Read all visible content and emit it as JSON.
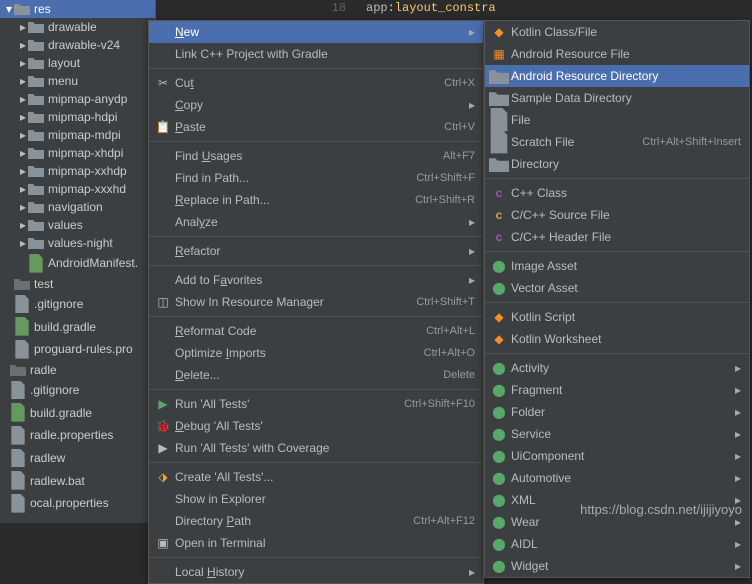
{
  "editor": {
    "line_number": "18",
    "code_prefix": "app",
    "code_attr": ":layout_constra"
  },
  "tree": [
    {
      "label": "res",
      "depth": 0,
      "arrow": "▾",
      "type": "folder",
      "selected": true
    },
    {
      "label": "drawable",
      "depth": 1,
      "arrow": "▸",
      "type": "folder"
    },
    {
      "label": "drawable-v24",
      "depth": 1,
      "arrow": "▸",
      "type": "folder"
    },
    {
      "label": "layout",
      "depth": 1,
      "arrow": "▸",
      "type": "folder"
    },
    {
      "label": "menu",
      "depth": 1,
      "arrow": "▸",
      "type": "folder"
    },
    {
      "label": "mipmap-anydp",
      "depth": 1,
      "arrow": "▸",
      "type": "folder"
    },
    {
      "label": "mipmap-hdpi",
      "depth": 1,
      "arrow": "▸",
      "type": "folder"
    },
    {
      "label": "mipmap-mdpi",
      "depth": 1,
      "arrow": "▸",
      "type": "folder"
    },
    {
      "label": "mipmap-xhdpi",
      "depth": 1,
      "arrow": "▸",
      "type": "folder"
    },
    {
      "label": "mipmap-xxhdp",
      "depth": 1,
      "arrow": "▸",
      "type": "folder"
    },
    {
      "label": "mipmap-xxxhd",
      "depth": 1,
      "arrow": "▸",
      "type": "folder"
    },
    {
      "label": "navigation",
      "depth": 1,
      "arrow": "▸",
      "type": "folder"
    },
    {
      "label": "values",
      "depth": 1,
      "arrow": "▸",
      "type": "folder"
    },
    {
      "label": "values-night",
      "depth": 1,
      "arrow": "▸",
      "type": "folder"
    },
    {
      "label": "AndroidManifest.",
      "depth": 1,
      "arrow": "",
      "type": "manifest"
    },
    {
      "label": "test",
      "depth": 0,
      "arrow": "",
      "type": "folder-dim"
    },
    {
      "label": ".gitignore",
      "depth": 0,
      "arrow": "",
      "type": "file",
      "root": true
    },
    {
      "label": "build.gradle",
      "depth": 0,
      "arrow": "",
      "type": "gradle",
      "root": true
    },
    {
      "label": "proguard-rules.pro",
      "depth": 0,
      "arrow": "",
      "type": "file",
      "root": true
    },
    {
      "label": "radle",
      "depth": 0,
      "arrow": "",
      "type": "folder-dim",
      "cut": true
    },
    {
      "label": ".gitignore",
      "depth": 0,
      "arrow": "",
      "type": "file",
      "cut": true
    },
    {
      "label": "build.gradle",
      "depth": 0,
      "arrow": "",
      "type": "gradle",
      "cut": true
    },
    {
      "label": "radle.properties",
      "depth": 0,
      "arrow": "",
      "type": "file",
      "cut": true
    },
    {
      "label": "radlew",
      "depth": 0,
      "arrow": "",
      "type": "file",
      "cut": true
    },
    {
      "label": "radlew.bat",
      "depth": 0,
      "arrow": "",
      "type": "file",
      "cut": true
    },
    {
      "label": "ocal.properties",
      "depth": 0,
      "arrow": "",
      "type": "file",
      "cut": true
    }
  ],
  "context_menu": [
    {
      "label": "New",
      "highlight": true,
      "submenu": true,
      "u": 0
    },
    {
      "label": "Link C++ Project with Gradle",
      "icon": ""
    },
    {
      "sep": true
    },
    {
      "label": "Cut",
      "shortcut": "Ctrl+X",
      "icon": "cut",
      "u": 2
    },
    {
      "label": "Copy",
      "submenu": true,
      "u": 0
    },
    {
      "label": "Paste",
      "shortcut": "Ctrl+V",
      "icon": "paste",
      "u": 0
    },
    {
      "sep": true
    },
    {
      "label": "Find Usages",
      "shortcut": "Alt+F7",
      "u": 5
    },
    {
      "label": "Find in Path...",
      "shortcut": "Ctrl+Shift+F"
    },
    {
      "label": "Replace in Path...",
      "shortcut": "Ctrl+Shift+R",
      "u": 0
    },
    {
      "label": "Analyze",
      "submenu": true,
      "u": 4
    },
    {
      "sep": true
    },
    {
      "label": "Refactor",
      "submenu": true,
      "u": 0
    },
    {
      "sep": true
    },
    {
      "label": "Add to Favorites",
      "submenu": true,
      "u": 8
    },
    {
      "label": "Show In Resource Manager",
      "shortcut": "Ctrl+Shift+T",
      "icon": "res"
    },
    {
      "sep": true
    },
    {
      "label": "Reformat Code",
      "shortcut": "Ctrl+Alt+L",
      "u": 0
    },
    {
      "label": "Optimize Imports",
      "shortcut": "Ctrl+Alt+O",
      "u": 9
    },
    {
      "label": "Delete...",
      "shortcut": "Delete",
      "u": 0
    },
    {
      "sep": true
    },
    {
      "label": "Run 'All Tests'",
      "shortcut": "Ctrl+Shift+F10",
      "icon": "run"
    },
    {
      "label": "Debug 'All Tests'",
      "icon": "debug",
      "u": 0
    },
    {
      "label": "Run 'All Tests' with Coverage",
      "icon": "coverage"
    },
    {
      "sep": true
    },
    {
      "label": "Create 'All Tests'...",
      "icon": "create"
    },
    {
      "label": "Show in Explorer"
    },
    {
      "label": "Directory Path",
      "shortcut": "Ctrl+Alt+F12",
      "u": 10
    },
    {
      "label": "Open in Terminal",
      "icon": "terminal"
    },
    {
      "sep": true
    },
    {
      "label": "Local History",
      "submenu": true,
      "u": 6
    }
  ],
  "submenu": [
    {
      "label": "Kotlin Class/File",
      "icon": "kotlin",
      "color": "#f88d2b"
    },
    {
      "label": "Android Resource File",
      "icon": "xml",
      "color": "#f88d2b"
    },
    {
      "label": "Android Resource Directory",
      "icon": "folder",
      "highlight": true
    },
    {
      "label": "Sample Data Directory",
      "icon": "folder"
    },
    {
      "label": "File",
      "icon": "file"
    },
    {
      "label": "Scratch File",
      "shortcut": "Ctrl+Alt+Shift+Insert",
      "icon": "file"
    },
    {
      "label": "Directory",
      "icon": "folder"
    },
    {
      "sep": true
    },
    {
      "label": "C++ Class",
      "icon": "cpp",
      "color": "#a050c0"
    },
    {
      "label": "C/C++ Source File",
      "icon": "cpp-src",
      "color": "#c9a94f"
    },
    {
      "label": "C/C++ Header File",
      "icon": "cpp-hdr",
      "color": "#a050c0"
    },
    {
      "sep": true
    },
    {
      "label": "Image Asset",
      "icon": "android"
    },
    {
      "label": "Vector Asset",
      "icon": "android"
    },
    {
      "sep": true
    },
    {
      "label": "Kotlin Script",
      "icon": "kotlin",
      "color": "#f88d2b"
    },
    {
      "label": "Kotlin Worksheet",
      "icon": "kotlin",
      "color": "#f88d2b"
    },
    {
      "sep": true
    },
    {
      "label": "Activity",
      "icon": "android-g",
      "submenu": true
    },
    {
      "label": "Fragment",
      "icon": "android-g",
      "submenu": true
    },
    {
      "label": "Folder",
      "icon": "android-g",
      "submenu": true
    },
    {
      "label": "Service",
      "icon": "android-g",
      "submenu": true
    },
    {
      "label": "UiComponent",
      "icon": "android-g",
      "submenu": true
    },
    {
      "label": "Automotive",
      "icon": "android-g",
      "submenu": true
    },
    {
      "label": "XML",
      "icon": "android-g",
      "submenu": true
    },
    {
      "label": "Wear",
      "icon": "android-g",
      "submenu": true
    },
    {
      "label": "AIDL",
      "icon": "android-g",
      "submenu": true
    },
    {
      "label": "Widget",
      "icon": "android-g",
      "submenu": true
    }
  ],
  "watermark": "https://blog.csdn.net/ijijiyoyo"
}
